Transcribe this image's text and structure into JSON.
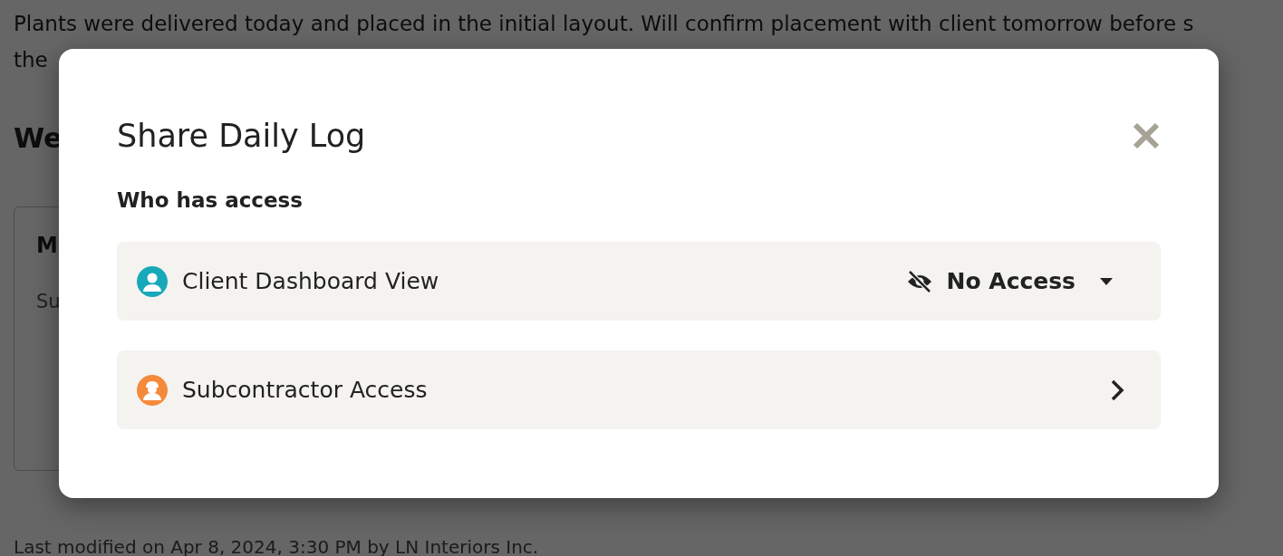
{
  "background": {
    "note_lines": [
      "Plants were delivered today and placed in the initial layout. Will confirm placement with client tomorrow before s",
      "the"
    ],
    "heading": "We",
    "card": {
      "title": "M",
      "text": "Su"
    },
    "footer": "Last modified on Apr 8, 2024, 3:30 PM by LN Interiors Inc."
  },
  "dialog": {
    "title": "Share Daily Log",
    "section_label": "Who has access",
    "items": [
      {
        "kind": "dropdown",
        "label": "Client Dashboard View",
        "color": "#17a9b9",
        "value": "No Access"
      },
      {
        "kind": "link",
        "label": "Subcontractor Access",
        "color": "#f58a3c"
      }
    ]
  }
}
